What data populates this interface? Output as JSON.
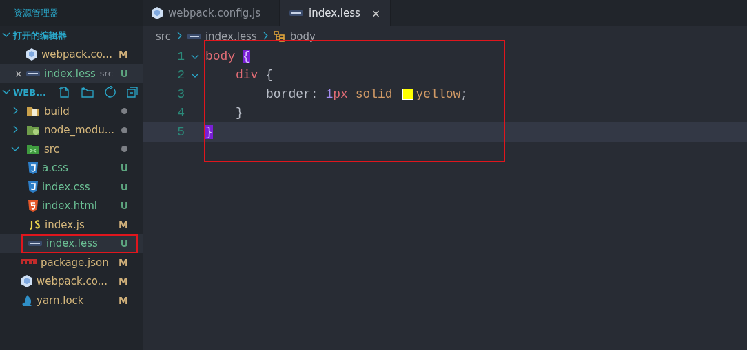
{
  "sidebar": {
    "title": "资源管理器",
    "open_editors": {
      "title": "打开的编辑器",
      "expanded": true,
      "items": [
        {
          "name": "webpack.co...",
          "kind": "webpack",
          "status": "M",
          "selected": false
        },
        {
          "name": "index.less",
          "detail": "src",
          "kind": "less",
          "status": "U",
          "selected": true,
          "close": "×"
        }
      ]
    },
    "project": {
      "title": "WEB...",
      "expanded": true,
      "tree": [
        {
          "name": "build",
          "kind": "build-folder",
          "expanded": false,
          "dot": true,
          "selected": false
        },
        {
          "name": "node_modu...",
          "kind": "node-folder",
          "expanded": false,
          "dot": true,
          "selected": false
        },
        {
          "name": "src",
          "kind": "src-folder",
          "expanded": true,
          "dot": true,
          "selected": false,
          "children": [
            {
              "name": "a.css",
              "kind": "css",
              "status": "U",
              "selected": false
            },
            {
              "name": "index.css",
              "kind": "css",
              "status": "U",
              "selected": false
            },
            {
              "name": "index.html",
              "kind": "html",
              "status": "U",
              "selected": false
            },
            {
              "name": "index.js",
              "kind": "js",
              "status": "M",
              "selected": false
            },
            {
              "name": "index.less",
              "kind": "less",
              "status": "U",
              "selected": true,
              "highlighted": true
            }
          ]
        },
        {
          "name": "package.json",
          "kind": "npm",
          "status": "M",
          "selected": false
        },
        {
          "name": "webpack.co...",
          "kind": "webpack",
          "status": "M",
          "selected": false
        },
        {
          "name": "yarn.lock",
          "kind": "yarn",
          "status": "M",
          "selected": false
        }
      ]
    }
  },
  "tabs": [
    {
      "label": "webpack.config.js",
      "kind": "webpack",
      "selected": false
    },
    {
      "label": "index.less",
      "kind": "less",
      "selected": true,
      "close": "×"
    }
  ],
  "breadcrumbs": [
    {
      "label": "src"
    },
    {
      "label": "index.less",
      "kind": "less"
    },
    {
      "label": "body",
      "kind": "symbol"
    }
  ],
  "editor": {
    "highlighted": true,
    "lines": [
      {
        "number": "1",
        "foldable": true,
        "current": false,
        "tokens": [
          {
            "kind": "selector",
            "text": "body "
          },
          {
            "kind": "bracket-match",
            "text": "{"
          }
        ],
        "children": [
          {
            "number": "2",
            "foldable": true,
            "current": false,
            "tokens": [
              {
                "kind": "selector",
                "text": "div"
              },
              {
                "kind": "plain",
                "text": " {"
              }
            ],
            "children": [
              {
                "number": "3",
                "foldable": false,
                "current": false,
                "tokens": [
                  {
                    "kind": "plain",
                    "text": "border: "
                  },
                  {
                    "kind": "number",
                    "text": "1"
                  },
                  {
                    "kind": "unit",
                    "text": "px"
                  },
                  {
                    "kind": "value",
                    "text": " solid "
                  },
                  {
                    "kind": "swatch",
                    "color": "#ffff00"
                  },
                  {
                    "kind": "value",
                    "text": "yellow"
                  },
                  {
                    "kind": "plain",
                    "text": ";"
                  }
                ]
              }
            ]
          },
          {
            "number": "4",
            "foldable": false,
            "current": false,
            "tokens": [
              {
                "kind": "plain",
                "text": "}"
              }
            ]
          }
        ]
      },
      {
        "number": "5",
        "foldable": false,
        "current": true,
        "tokens": [
          {
            "kind": "bracket-match",
            "text": "}"
          }
        ]
      }
    ]
  }
}
